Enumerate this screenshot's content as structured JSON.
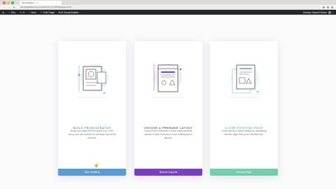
{
  "browser": {
    "tab_title": "Test Sandbox",
    "url": "dev.elegantthemes.com/test/?et_fb=1&PageSpeed=off"
  },
  "adminbar": {
    "site": "Dev",
    "comments": "0",
    "new": "New",
    "edit": "Edit Page",
    "exit": "Exit Visual Builder",
    "user": "Howdy, Nayeli Hidder"
  },
  "cards": [
    {
      "title": "BUILD FROM SCRATCH",
      "desc": "Build your page from the ground up. Don't worry, you can access our premade layouts at any time.",
      "button": "Start Building",
      "color": "#5b9bd5",
      "title_color": "#4a8ec9"
    },
    {
      "title": "CHOOSE A PREMADE LAYOUT",
      "desc": "Choose from hundreds of world-class premade layouts or start from any of your existing saved layouts.",
      "button": "Browse Layouts",
      "color": "#7b3fc4",
      "title_color": "#555555"
    },
    {
      "title": "CLONE EXISTING PAGE",
      "desc": "Jump start your layout design by duplicating another page that you've already built.",
      "button": "Choose Page",
      "color": "#6fd0aa",
      "title_color": "#4bbf95"
    }
  ],
  "colors": {
    "accent_blue": "#5b9bd5",
    "accent_purple": "#7b3fc4",
    "accent_green": "#6fd0aa"
  }
}
